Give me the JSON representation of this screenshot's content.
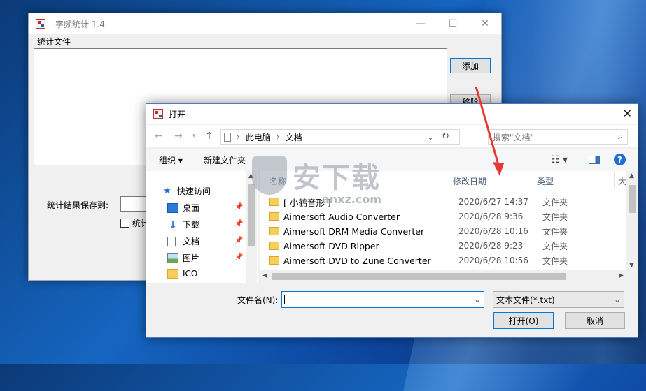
{
  "app": {
    "title": "字频统计 1.4",
    "file_group_label": "统计文件",
    "add_button": "添加",
    "remove_button": "移除",
    "save_label": "统计结果保存到:",
    "checkbox_label": "统计",
    "window_buttons": {
      "minimize": "—",
      "maximize": "☐",
      "close": "✕"
    }
  },
  "dialog": {
    "title": "打开",
    "close": "✕",
    "breadcrumb": [
      "此电脑",
      "文档"
    ],
    "search_placeholder": "搜索\"文档\"",
    "toolbar": {
      "organize": "组织 ▾",
      "new_folder": "新建文件夹"
    },
    "nav_pane": [
      {
        "label": "快速访问",
        "icon": "star-icon"
      },
      {
        "label": "桌面",
        "icon": "desktop-icon",
        "pinned": true
      },
      {
        "label": "下载",
        "icon": "download-icon",
        "pinned": true
      },
      {
        "label": "文档",
        "icon": "document-icon",
        "pinned": true
      },
      {
        "label": "图片",
        "icon": "picture-icon",
        "pinned": true
      },
      {
        "label": "ICO",
        "icon": "folder-icon"
      }
    ],
    "columns": {
      "name": "名称",
      "date": "修改日期",
      "type": "类型",
      "size": "大"
    },
    "rows": [
      {
        "name": "[ 小鹤音形 ]",
        "date": "2020/6/27 14:37",
        "type": "文件夹"
      },
      {
        "name": "Aimersoft Audio Converter",
        "date": "2020/6/28 9:36",
        "type": "文件夹"
      },
      {
        "name": "Aimersoft DRM Media Converter",
        "date": "2020/6/28 10:16",
        "type": "文件夹"
      },
      {
        "name": "Aimersoft DVD Ripper",
        "date": "2020/6/28 9:23",
        "type": "文件夹"
      },
      {
        "name": "Aimersoft DVD to Zune Converter",
        "date": "2020/6/28 10:56",
        "type": "文件夹"
      }
    ],
    "filename_label": "文件名(N):",
    "filename_value": "",
    "filter_value": "文本文件(*.txt)",
    "open_button": "打开(O)",
    "cancel_button": "取消"
  },
  "watermark": {
    "text": "安下载",
    "url": "anxz.com"
  },
  "colors": {
    "accent": "#0078d7",
    "arrow": "#e53935",
    "folder": "#f6cf5a"
  }
}
